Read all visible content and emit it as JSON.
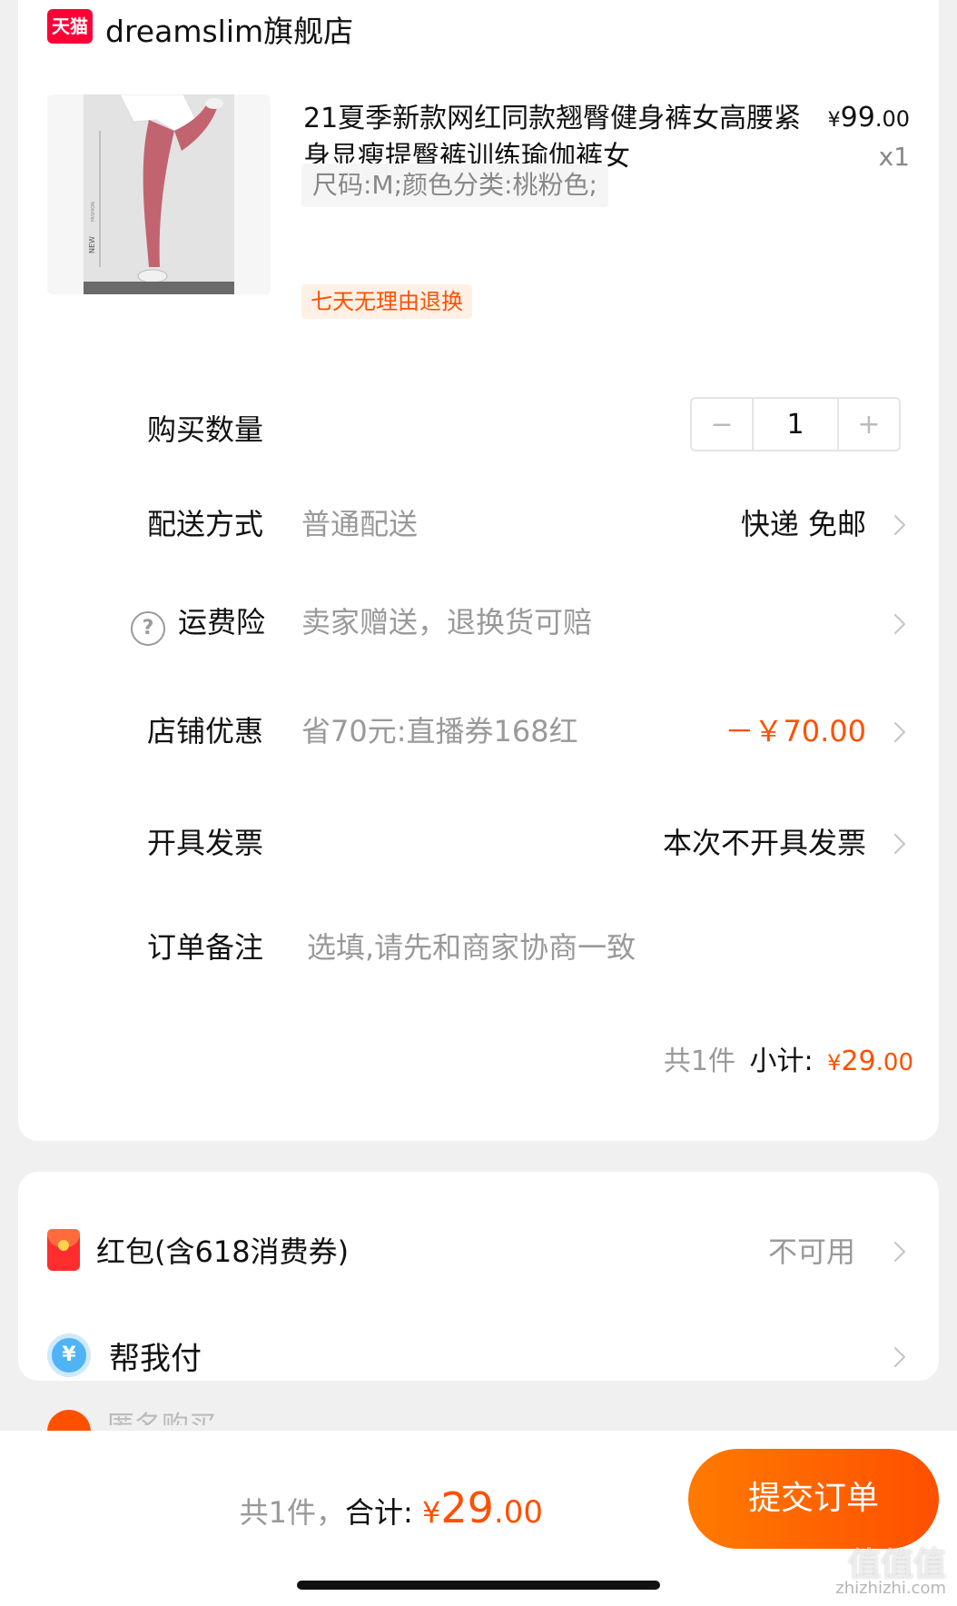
{
  "store": {
    "badge": "天猫",
    "name": "dreamslim旗舰店"
  },
  "product": {
    "title": "21夏季新款网红同款翘臀健身裤女高腰紧身显瘦提臀裤训练瑜伽裤女",
    "price_currency": "¥",
    "price_int": "99",
    "price_dec": ".00",
    "quantity_label": "x1",
    "sku": "尺码:M;颜色分类:桃粉色;",
    "return_policy": "七天无理由退换",
    "image_text_new": "NEW",
    "image_text_fashion": "FASHION"
  },
  "rows": {
    "quantity": {
      "label": "购买数量",
      "value": "1",
      "minus": "−",
      "plus": "+"
    },
    "delivery": {
      "label": "配送方式",
      "sub": "普通配送",
      "value": "快递 免邮"
    },
    "insurance": {
      "label": "运费险",
      "sub": "卖家赠送，退换货可赔",
      "icon": "?"
    },
    "discount": {
      "label": "店铺优惠",
      "sub": "省70元:直播券168红",
      "value": "－￥70.00"
    },
    "invoice": {
      "label": "开具发票",
      "value": "本次不开具发票"
    },
    "note": {
      "label": "订单备注",
      "placeholder": "选填,请先和商家协商一致"
    }
  },
  "subtotal": {
    "count": "共1件",
    "label": "小计:",
    "currency": "¥",
    "int": "29",
    "dec": ".00"
  },
  "benefits": {
    "redpacket": {
      "label": "红包(含618消费券)",
      "value": "不可用"
    },
    "pay_for_me": {
      "label": "帮我付",
      "icon": "¥"
    }
  },
  "peek": {
    "label": "匿名购买"
  },
  "bottom_bar": {
    "count": "共1件，",
    "label": "合计:",
    "currency": "¥",
    "int": "29",
    "dec": ".00",
    "submit": "提交订单"
  },
  "watermark": {
    "main": "值值值",
    "sub": "zhizhizhi.com"
  },
  "colors": {
    "accent": "#ff5000",
    "tmall_red": "#ff0036",
    "background": "#f0f0f0"
  }
}
